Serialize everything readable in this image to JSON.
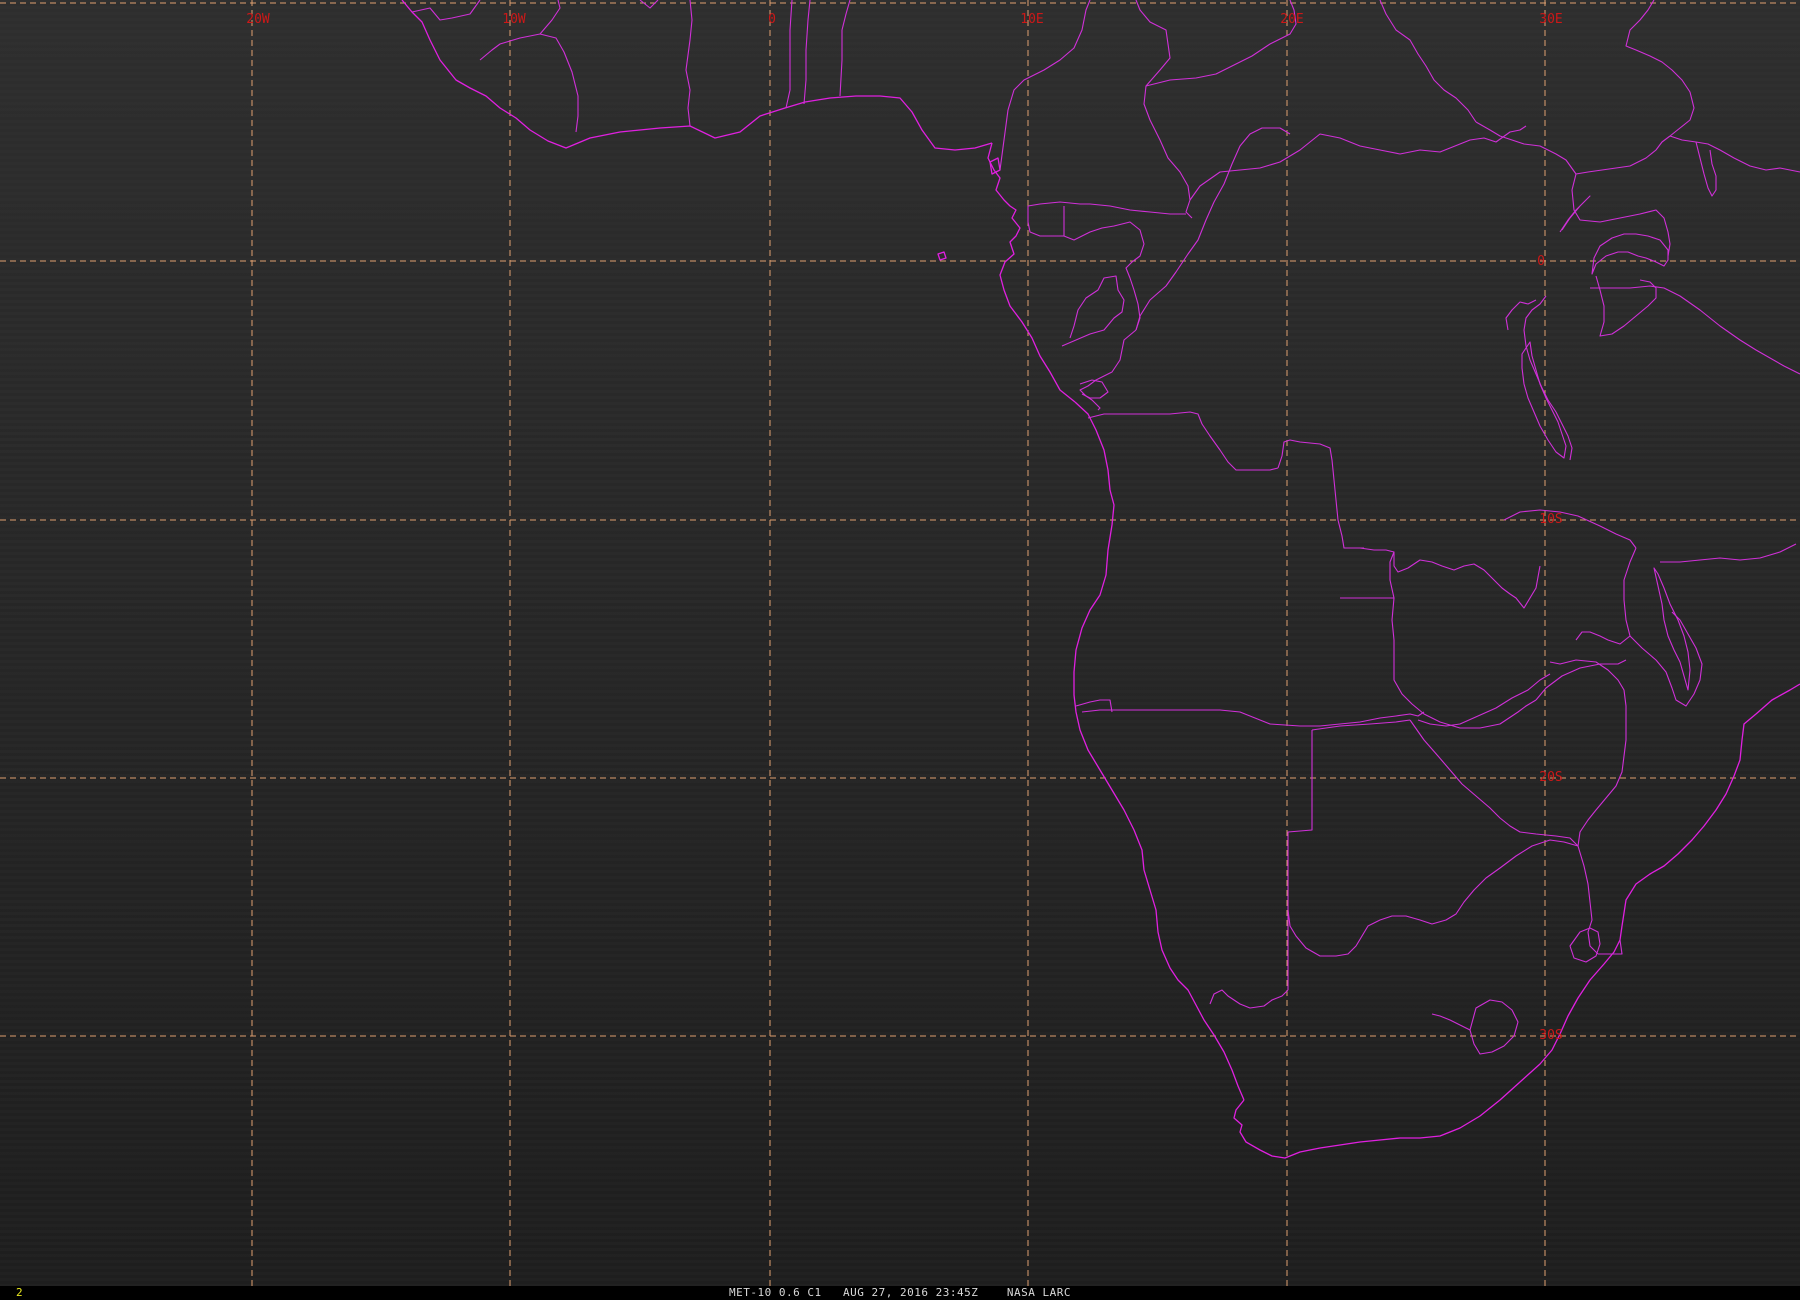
{
  "map": {
    "colors": {
      "background_top": "#2e2e2e",
      "background_bottom": "#1e1e1e",
      "grid": "#e0a070",
      "grid_label": "#cc1818",
      "boundaries": "#e020e0",
      "frame_number": "#e8e820",
      "footer_text": "#d8d8d8"
    },
    "longitude_labels": [
      "20W",
      "10W",
      "0",
      "10E",
      "20E",
      "30E"
    ],
    "latitude_labels": [
      "0",
      "10S",
      "20S",
      "30S"
    ]
  },
  "footer": {
    "frame_number": "2",
    "satellite": "MET-10",
    "channel": "0.6 C1",
    "datetime": "AUG 27, 2016 23:45Z",
    "producer": "NASA LARC"
  }
}
